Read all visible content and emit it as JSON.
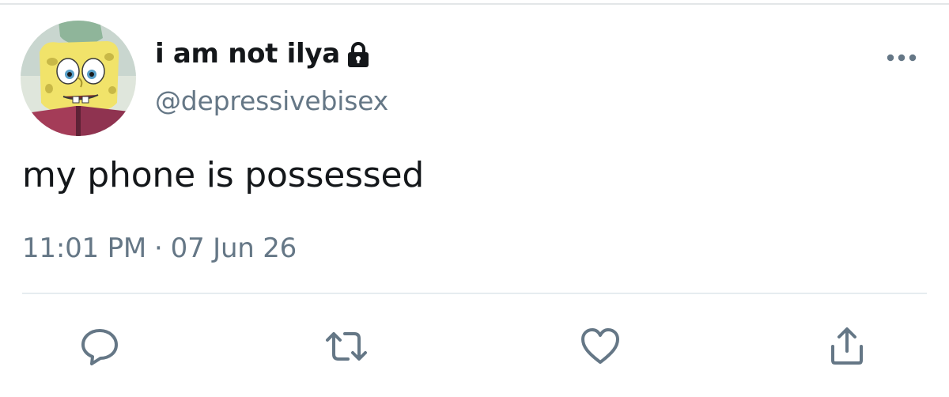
{
  "tweet": {
    "display_name": "i am not ilya",
    "handle": "@depressivebisex",
    "text": "my phone is possessed",
    "time": "11:01 PM",
    "separator": "·",
    "date": "07 Jun 26"
  },
  "icons": {
    "protected": "lock-icon",
    "more": "more-dots-icon",
    "reply": "reply-bubble-icon",
    "retweet": "retweet-icon",
    "like": "heart-icon",
    "share": "share-upload-icon"
  },
  "colors": {
    "text_primary": "#14171a",
    "text_secondary": "#657786",
    "icon": "#657786",
    "divider": "#e6ecf0"
  }
}
